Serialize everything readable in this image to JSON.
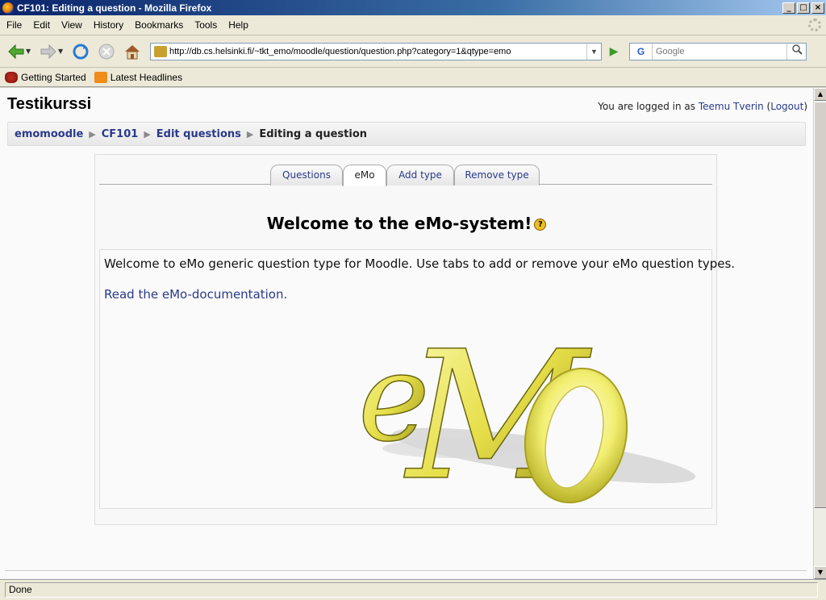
{
  "window": {
    "title": "CF101: Editing a question - Mozilla Firefox",
    "buttons": {
      "minimize": "_",
      "maximize": "□",
      "close": "×"
    }
  },
  "menubar": {
    "items": [
      {
        "label": "File"
      },
      {
        "label": "Edit"
      },
      {
        "label": "View"
      },
      {
        "label": "History"
      },
      {
        "label": "Bookmarks"
      },
      {
        "label": "Tools"
      },
      {
        "label": "Help"
      }
    ]
  },
  "toolbar": {
    "url": "http://db.cs.helsinki.fi/~tkt_emo/moodle/question/question.php?category=1&qtype=emo",
    "search_placeholder": "Google"
  },
  "bookmarks": {
    "items": [
      {
        "label": "Getting Started"
      },
      {
        "label": "Latest Headlines"
      }
    ]
  },
  "page": {
    "site_name": "Testikurssi",
    "login": {
      "prefix": "You are logged in as",
      "user": "Teemu Tverin",
      "logout": "Logout"
    },
    "breadcrumb": [
      {
        "label": "emomoodle",
        "link": true
      },
      {
        "label": "CF101",
        "link": true
      },
      {
        "label": "Edit questions",
        "link": true
      },
      {
        "label": "Editing a question",
        "link": false
      }
    ],
    "tabs": [
      {
        "label": "Questions",
        "active": false
      },
      {
        "label": "eMo",
        "active": true
      },
      {
        "label": "Add type",
        "active": false
      },
      {
        "label": "Remove type",
        "active": false
      }
    ],
    "heading": "Welcome to the eMo-system!",
    "help_icon_glyph": "?",
    "intro": "Welcome to eMo generic question type for Moodle. Use tabs to add or remove your eMo question types.",
    "doc_link": "Read the eMo-documentation",
    "doc_link_suffix": ".",
    "logo_text": "eMo"
  },
  "status": {
    "text": "Done"
  },
  "colors": {
    "link": "#2a3a8a",
    "logo_gold": "#e8e040",
    "logo_shadow": "#b0b0b0"
  }
}
